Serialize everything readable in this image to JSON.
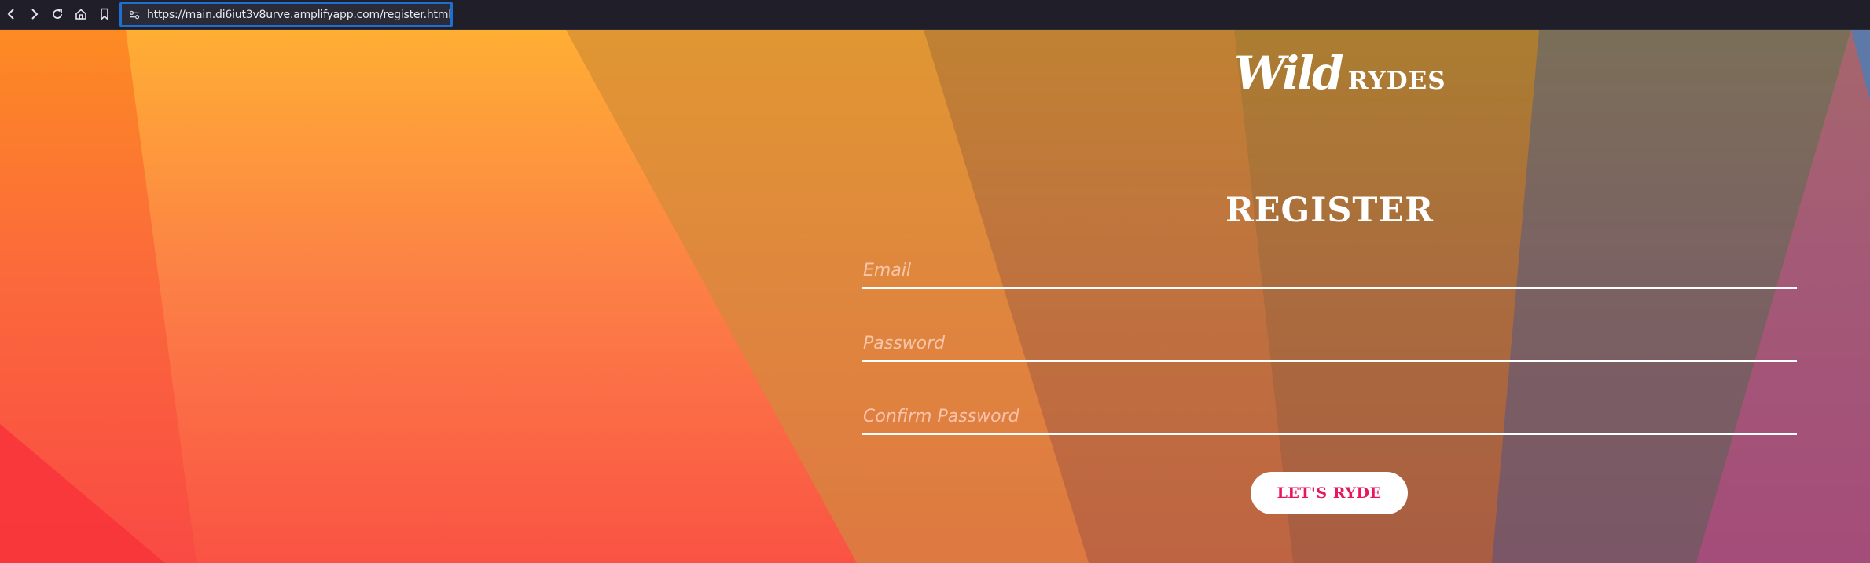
{
  "browser": {
    "url": "https://main.di6iut3v8urve.amplifyapp.com/register.html",
    "url_border_color": "#1f6fd1",
    "nav": {
      "back_icon": "chevron-left-icon",
      "forward_icon": "chevron-right-icon",
      "reload_icon": "reload-icon",
      "home_icon": "home-icon",
      "bookmark_icon": "bookmark-icon",
      "site_info_icon": "site-settings-icon"
    }
  },
  "page": {
    "logo": {
      "script": "Wild",
      "caps": "RYDES"
    },
    "title": "REGISTER",
    "form": {
      "email_placeholder": "Email",
      "password_placeholder": "Password",
      "confirm_placeholder": "Confirm Password",
      "submit_label": "LET'S RYDE"
    },
    "colors": {
      "button_text": "#e8175d",
      "gradient_top": "#fd8b22",
      "gradient_bottom": "#f94a44"
    }
  }
}
